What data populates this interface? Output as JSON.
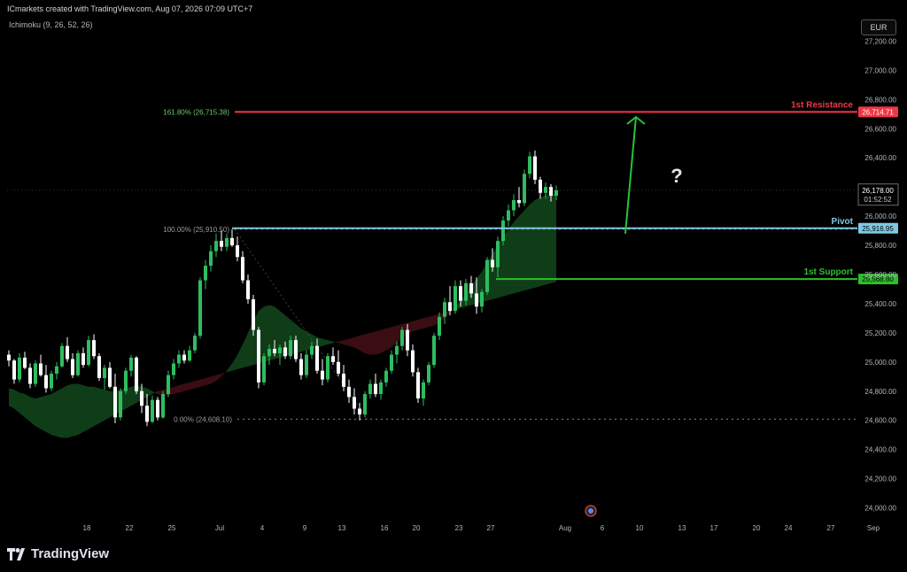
{
  "header": {
    "credit": "ICmarkets created with TradingView.com, Aug 07, 2026 07:09 UTC+7",
    "indicator": "Ichimoku (9, 26, 52, 26)",
    "currency": "EUR"
  },
  "brand": {
    "name": "TradingView",
    "logo_icon": "tradingview-logo-icon"
  },
  "colors": {
    "bull": "#2ebd5f",
    "bear": "#ffffff",
    "resistance": "#f23645",
    "pivot": "#7ec8e3",
    "support": "#2ebd2e",
    "cloud_bull": "#0f3d17",
    "cloud_bear": "#3a0d12",
    "fib_green": "#6ec96e",
    "arrow": "#22c43a"
  },
  "chart_data": {
    "type": "candlestick",
    "title": "",
    "instrument_currency": "EUR",
    "price_axis": {
      "range": [
        23900,
        27300
      ],
      "ticks": [
        24000,
        24200,
        24400,
        24600,
        24800,
        25000,
        25200,
        25400,
        25600,
        25800,
        26000,
        26200,
        26400,
        26600,
        26800,
        27000,
        27200
      ],
      "tick_labels": [
        "24,000.00",
        "24,200.00",
        "24,400.00",
        "24,600.00",
        "24,800.00",
        "25,000.00",
        "25,200.00",
        "25,400.00",
        "25,600.00",
        "25,800.00",
        "26,000.00",
        "26,200.00",
        "26,400.00",
        "26,600.00",
        "26,800.00",
        "27,000.00",
        "27,200.00"
      ]
    },
    "time_axis": {
      "labels": [
        "18",
        "22",
        "25",
        "Jul",
        "4",
        "9",
        "13",
        "16",
        "20",
        "23",
        "27",
        "Aug",
        "6",
        "10",
        "13",
        "17",
        "20",
        "24",
        "27",
        "Sep"
      ],
      "label_positions_index": [
        8,
        16,
        24,
        33,
        41,
        49,
        56,
        64,
        70,
        78,
        84,
        98,
        105,
        112,
        120,
        126,
        134,
        140,
        148,
        156
      ]
    },
    "current_price": {
      "label": "26,178.00",
      "countdown": "01:52:52",
      "value": 26178
    },
    "levels": [
      {
        "name": "1st Resistance",
        "value": 26714.71,
        "label": "26,714.71"
      },
      {
        "name": "Pivot",
        "value": 25916.95,
        "label": "25,916.95"
      },
      {
        "name": "1st Support",
        "value": 25568.8,
        "label": "25,568.80"
      }
    ],
    "fib_levels": [
      {
        "label": "161.80% (26,715.38)",
        "value": 26715.38
      },
      {
        "label": "100.00% (25,910.50)",
        "value": 25910.5
      },
      {
        "label": "0.00% (24,608.10)",
        "value": 24608.1
      }
    ],
    "annotation": {
      "text": "?",
      "arrow_to": 26680
    },
    "candles": [
      [
        25050,
        25080,
        24970,
        25010
      ],
      [
        25010,
        25020,
        24850,
        24880
      ],
      [
        24880,
        25060,
        24860,
        25030
      ],
      [
        25030,
        25070,
        24950,
        24960
      ],
      [
        24960,
        24990,
        24820,
        24850
      ],
      [
        24850,
        25010,
        24830,
        24990
      ],
      [
        24990,
        25050,
        24900,
        24910
      ],
      [
        24910,
        24980,
        24790,
        24820
      ],
      [
        24820,
        24940,
        24800,
        24920
      ],
      [
        24920,
        25000,
        24880,
        24970
      ],
      [
        24970,
        25130,
        24960,
        25110
      ],
      [
        25110,
        25170,
        25000,
        25020
      ],
      [
        25020,
        25060,
        24890,
        24910
      ],
      [
        24910,
        25080,
        24900,
        25060
      ],
      [
        25060,
        25100,
        24960,
        24980
      ],
      [
        24980,
        25180,
        24970,
        25150
      ],
      [
        25150,
        25190,
        25020,
        25040
      ],
      [
        25040,
        25060,
        24870,
        24890
      ],
      [
        24890,
        24980,
        24810,
        24960
      ],
      [
        24960,
        25000,
        24820,
        24830
      ],
      [
        24830,
        24920,
        24580,
        24620
      ],
      [
        24620,
        24820,
        24600,
        24800
      ],
      [
        24800,
        24960,
        24780,
        24940
      ],
      [
        24940,
        25050,
        24900,
        25030
      ],
      [
        25030,
        25040,
        24780,
        24800
      ],
      [
        24800,
        24850,
        24650,
        24700
      ],
      [
        24700,
        24780,
        24560,
        24590
      ],
      [
        24590,
        24770,
        24580,
        24740
      ],
      [
        24740,
        24760,
        24600,
        24620
      ],
      [
        24620,
        24800,
        24610,
        24780
      ],
      [
        24780,
        24940,
        24760,
        24910
      ],
      [
        24910,
        25020,
        24880,
        24990
      ],
      [
        24990,
        25080,
        24960,
        25050
      ],
      [
        25050,
        25080,
        24990,
        25010
      ],
      [
        25010,
        25110,
        25000,
        25080
      ],
      [
        25080,
        25200,
        25060,
        25180
      ],
      [
        25180,
        25580,
        25160,
        25560
      ],
      [
        25560,
        25700,
        25500,
        25660
      ],
      [
        25660,
        25800,
        25620,
        25760
      ],
      [
        25760,
        25880,
        25720,
        25830
      ],
      [
        25830,
        25900,
        25760,
        25790
      ],
      [
        25790,
        25880,
        25760,
        25850
      ],
      [
        25850,
        25910,
        25790,
        25800
      ],
      [
        25800,
        25860,
        25690,
        25720
      ],
      [
        25720,
        25760,
        25540,
        25560
      ],
      [
        25560,
        25600,
        25400,
        25430
      ],
      [
        25430,
        25460,
        25180,
        25220
      ],
      [
        25220,
        25240,
        24820,
        24860
      ],
      [
        24860,
        25060,
        24840,
        25040
      ],
      [
        25040,
        25120,
        24980,
        25090
      ],
      [
        25090,
        25150,
        25040,
        25060
      ],
      [
        25060,
        25120,
        24980,
        25100
      ],
      [
        25100,
        25140,
        25020,
        25040
      ],
      [
        25040,
        25180,
        25020,
        25150
      ],
      [
        25150,
        25180,
        25000,
        25020
      ],
      [
        25020,
        25060,
        24880,
        24910
      ],
      [
        24910,
        25080,
        24890,
        25050
      ],
      [
        25050,
        25140,
        25020,
        25110
      ],
      [
        25110,
        25160,
        24920,
        24940
      ],
      [
        24940,
        25020,
        24840,
        24880
      ],
      [
        24880,
        25060,
        24860,
        25040
      ],
      [
        25040,
        25100,
        24980,
        25000
      ],
      [
        25000,
        25080,
        24900,
        24920
      ],
      [
        24920,
        24980,
        24800,
        24830
      ],
      [
        24830,
        24880,
        24720,
        24760
      ],
      [
        24760,
        24820,
        24640,
        24680
      ],
      [
        24680,
        24720,
        24600,
        24640
      ],
      [
        24640,
        24800,
        24620,
        24780
      ],
      [
        24780,
        24880,
        24750,
        24850
      ],
      [
        24850,
        24920,
        24760,
        24780
      ],
      [
        24780,
        24880,
        24740,
        24860
      ],
      [
        24860,
        24960,
        24830,
        24940
      ],
      [
        24940,
        25080,
        24920,
        25050
      ],
      [
        25050,
        25140,
        24990,
        25110
      ],
      [
        25110,
        25240,
        25080,
        25220
      ],
      [
        25220,
        25260,
        25040,
        25080
      ],
      [
        25080,
        25120,
        24900,
        24930
      ],
      [
        24930,
        24960,
        24720,
        24750
      ],
      [
        24750,
        24880,
        24700,
        24860
      ],
      [
        24860,
        25000,
        24840,
        24980
      ],
      [
        24980,
        25200,
        24960,
        25180
      ],
      [
        25180,
        25340,
        25150,
        25310
      ],
      [
        25310,
        25440,
        25260,
        25410
      ],
      [
        25410,
        25520,
        25320,
        25350
      ],
      [
        25350,
        25560,
        25330,
        25520
      ],
      [
        25520,
        25560,
        25380,
        25420
      ],
      [
        25420,
        25570,
        25390,
        25540
      ],
      [
        25540,
        25590,
        25440,
        25470
      ],
      [
        25470,
        25580,
        25330,
        25380
      ],
      [
        25380,
        25500,
        25340,
        25480
      ],
      [
        25480,
        25720,
        25460,
        25700
      ],
      [
        25700,
        25780,
        25620,
        25650
      ],
      [
        25650,
        25860,
        25580,
        25830
      ],
      [
        25830,
        26000,
        25800,
        25970
      ],
      [
        25970,
        26080,
        25930,
        26040
      ],
      [
        26040,
        26150,
        26000,
        26110
      ],
      [
        26110,
        26200,
        26060,
        26090
      ],
      [
        26090,
        26320,
        26070,
        26290
      ],
      [
        26290,
        26440,
        26260,
        26410
      ],
      [
        26410,
        26450,
        26220,
        26250
      ],
      [
        26250,
        26270,
        26120,
        26160
      ],
      [
        26160,
        26230,
        26120,
        26200
      ],
      [
        26200,
        26220,
        26100,
        26140
      ],
      [
        26140,
        26210,
        26110,
        26178
      ]
    ],
    "cloud": {
      "span_a": [
        24820,
        24810,
        24790,
        24780,
        24760,
        24750,
        24760,
        24770,
        24780,
        24800,
        24820,
        24840,
        24850,
        24850,
        24840,
        24830,
        24830,
        24820,
        24810,
        24800,
        24800,
        24810,
        24820,
        24830,
        24840,
        24830,
        24820,
        24800,
        24780,
        24770,
        24770,
        24780,
        24790,
        24800,
        24810,
        24820,
        24830,
        24840,
        24850,
        24870,
        24900,
        24940,
        24990,
        25050,
        25120,
        25200,
        25280,
        25350,
        25380,
        25390,
        25380,
        25350,
        25320,
        25290,
        25260,
        25230,
        25210,
        25190,
        25170,
        25160,
        25150,
        25140,
        25130,
        25120,
        25110,
        25100,
        25080,
        25060,
        25050,
        25050,
        25060,
        25080,
        25100,
        25130,
        25160,
        25190,
        25210,
        25220,
        25230,
        25240,
        25250,
        25270,
        25300,
        25340,
        25380,
        25420,
        25470,
        25520,
        25570,
        25620,
        25680,
        25740,
        25800,
        25860,
        25910,
        25960,
        26000,
        26040,
        26080,
        26110,
        26130,
        26140,
        26150,
        26150
      ],
      "span_b": [
        24700,
        24680,
        24650,
        24620,
        24590,
        24560,
        24540,
        24520,
        24500,
        24490,
        24480,
        24480,
        24490,
        24500,
        24520,
        24540,
        24560,
        24580,
        24600,
        24620,
        24640,
        24660,
        24680,
        24700,
        24720,
        24740,
        24760,
        24780,
        24800,
        24810,
        24820,
        24830,
        24840,
        24850,
        24860,
        24870,
        24880,
        24890,
        24900,
        24910,
        24920,
        24930,
        24940,
        24950,
        24960,
        24970,
        24980,
        24990,
        25000,
        25010,
        25020,
        25030,
        25040,
        25050,
        25060,
        25070,
        25080,
        25090,
        25100,
        25110,
        25120,
        25130,
        25140,
        25150,
        25160,
        25170,
        25180,
        25190,
        25200,
        25210,
        25220,
        25230,
        25240,
        25250,
        25260,
        25270,
        25280,
        25290,
        25300,
        25310,
        25320,
        25330,
        25340,
        25350,
        25360,
        25370,
        25380,
        25390,
        25400,
        25410,
        25420,
        25430,
        25440,
        25450,
        25460,
        25470,
        25480,
        25490,
        25500,
        25510,
        25520,
        25530,
        25540,
        25550
      ]
    }
  }
}
